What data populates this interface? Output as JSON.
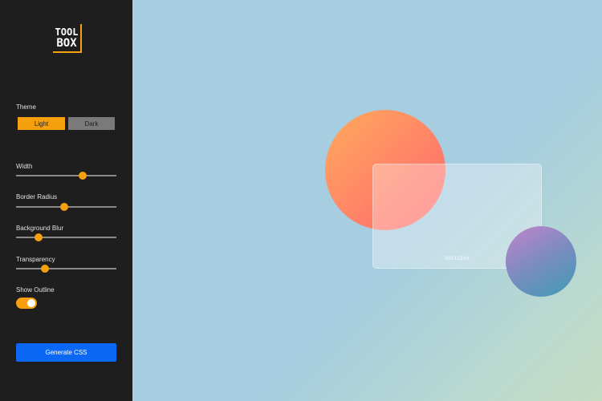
{
  "logo": {
    "line1": "TOOL",
    "line2": "BOX"
  },
  "sidebar": {
    "theme_label": "Theme",
    "theme_options": [
      "Light",
      "Dark"
    ],
    "theme_selected": "Light",
    "sliders": [
      {
        "label": "Width",
        "value_fraction": 0.66
      },
      {
        "label": "Border Radius",
        "value_fraction": 0.48
      },
      {
        "label": "Background Blur",
        "value_fraction": 0.22
      },
      {
        "label": "Transparency",
        "value_fraction": 0.29
      }
    ],
    "outline_label": "Show Outline",
    "outline_on": true,
    "generate_label": "Generate CSS"
  },
  "preview": {
    "card_text": "09011994"
  },
  "colors": {
    "sidebar_bg": "#1e1e1e",
    "accent": "#f5a00c",
    "primary_button": "#0b68f5",
    "canvas_bg": "#a6cde0"
  }
}
